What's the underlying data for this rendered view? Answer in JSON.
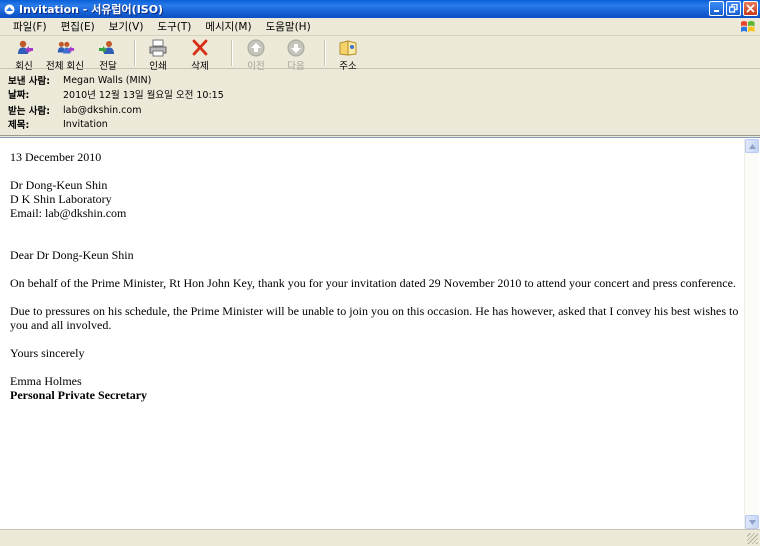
{
  "window": {
    "title": "Invitation - 서유럽어(ISO)"
  },
  "menu": [
    "파일(F)",
    "편집(E)",
    "보기(V)",
    "도구(T)",
    "메시지(M)",
    "도움말(H)"
  ],
  "toolbar": {
    "reply": "회신",
    "reply_all": "전체 회신",
    "forward": "전달",
    "print": "인쇄",
    "delete": "삭제",
    "previous": "이전",
    "next": "다음",
    "addresses": "주소"
  },
  "header": {
    "from_label": "보낸 사람:",
    "from_value": "Megan Walls (MIN)",
    "date_label": "날짜:",
    "date_value": "2010년 12월 13일 월요일 오전 10:15",
    "to_label": "받는 사람:",
    "to_value": "lab@dkshin.com",
    "subject_label": "제목:",
    "subject_value": "Invitation"
  },
  "letter": {
    "date": "13 December 2010",
    "addr_name": "Dr Dong-Keun Shin",
    "addr_org": "D K Shin Laboratory",
    "addr_email": "Email: lab@dkshin.com",
    "salutation": "Dear Dr Dong-Keun Shin",
    "para1": "On behalf of the Prime Minister, Rt Hon John Key, thank you for your invitation dated 29 November 2010 to attend your concert and press conference.",
    "para2": "Due to pressures on his schedule, the Prime Minister will be unable to join you on this occasion.  He has however, asked that I convey his best wishes to you and all involved.",
    "closing": "Yours sincerely",
    "sig_name": "Emma Holmes",
    "sig_title": "Personal Private Secretary"
  },
  "icons": {
    "reply": "reply-icon",
    "reply_all": "reply-all-icon",
    "forward": "forward-icon",
    "print": "printer-icon",
    "delete": "delete-x-icon",
    "previous": "up-arrow-icon",
    "next": "down-arrow-icon",
    "addresses": "address-book-icon"
  }
}
